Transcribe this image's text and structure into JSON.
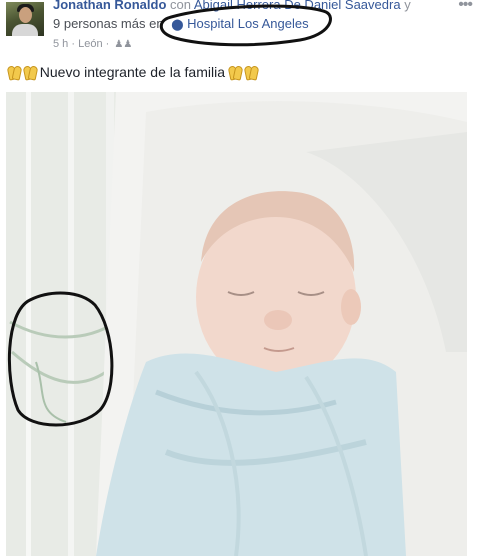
{
  "post": {
    "author": "Jonathan Ronaldo",
    "with_text": "con",
    "tagged_friend": "Abigail Herrera De Daniel Saavedra",
    "and_text": "y",
    "others_text": "9 personas más",
    "at_text": "en",
    "location": "Hospital Los Angeles",
    "time": "5 h",
    "separator": "·",
    "place": "León",
    "audience_icon": "friends-icon",
    "message": "Nuevo integrante de la familia",
    "emoji": "folded-hands-emoji"
  },
  "colors": {
    "link": "#365899",
    "secondary_text": "#90949c",
    "marker": "#111111"
  }
}
